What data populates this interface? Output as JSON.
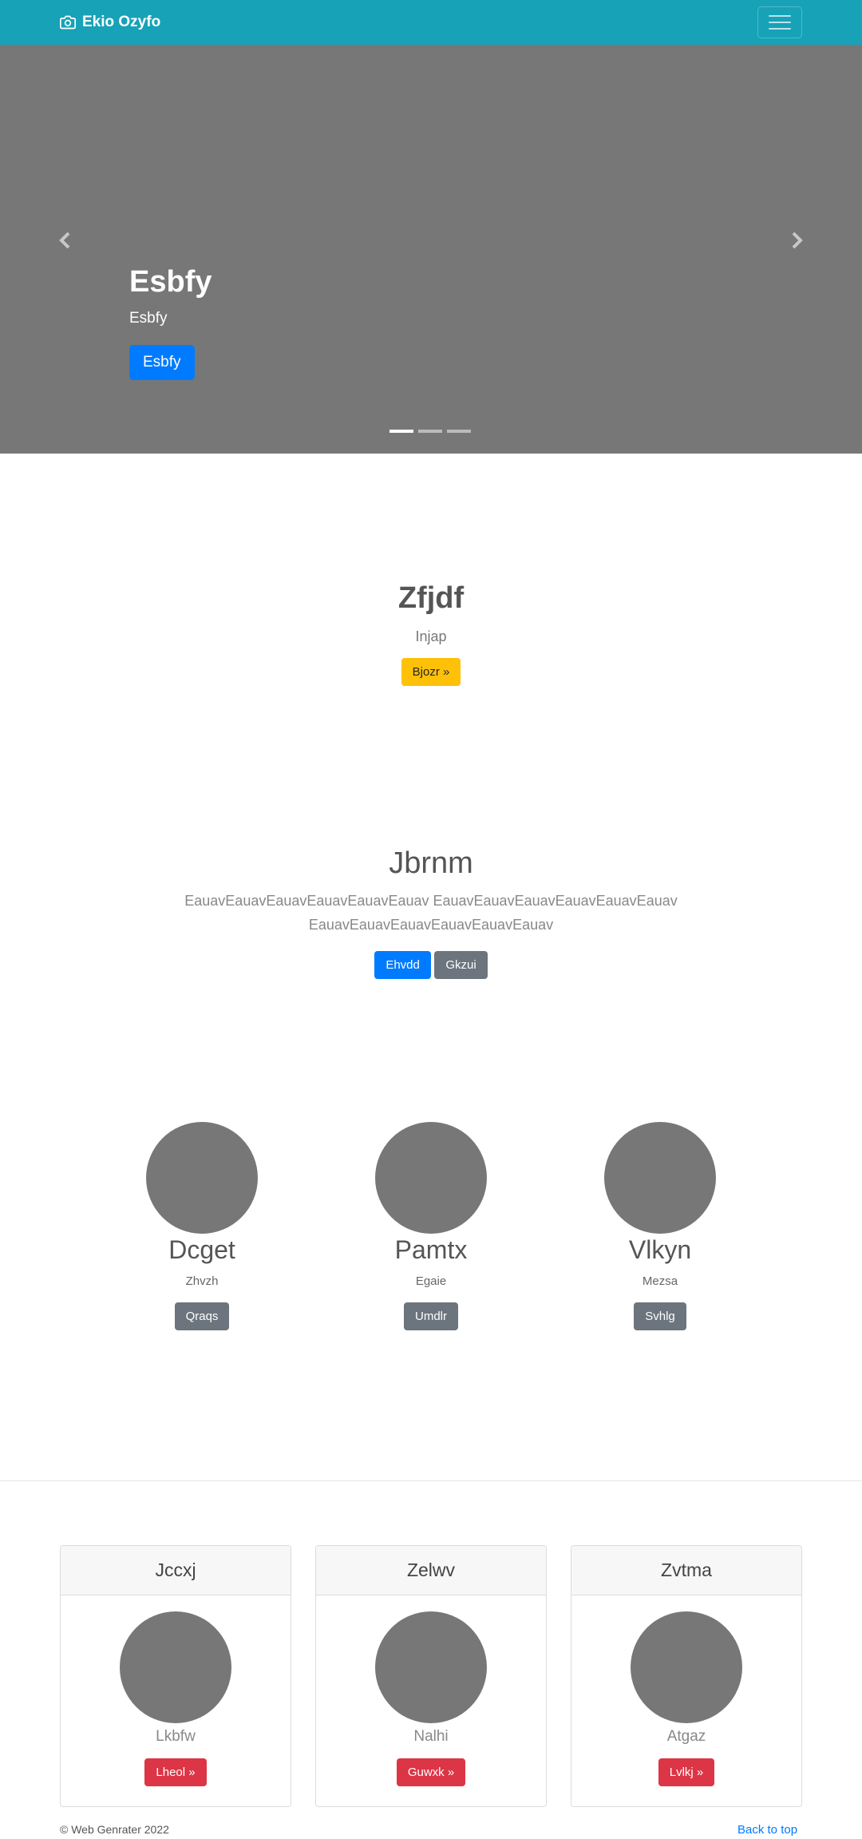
{
  "navbar": {
    "brand": "Ekio Ozyfo",
    "brand_icon": "camera-icon",
    "menu_icon": "hamburger-icon",
    "color": "#17a2b8"
  },
  "carousel": {
    "title": "Esbfy",
    "text": "Esbfy",
    "button": "Esbfy",
    "prev_icon": "chevron-left-icon",
    "next_icon": "chevron-right-icon",
    "slides": 3,
    "active_slide": 1
  },
  "feature": {
    "title": "Zfjdf",
    "subtitle": "Injap",
    "button": "Bjozr »"
  },
  "jumbo": {
    "title": "Jbrnm",
    "text": "EauavEauavEauavEauavEauavEauav EauavEauavEauavEauavEauavEauav EauavEauavEauavEauavEauavEauav",
    "primary_button": "Ehvdd",
    "secondary_button": "Gkzui"
  },
  "circles": [
    {
      "name": "Dcget",
      "sub": "Zhvzh",
      "button": "Qraqs"
    },
    {
      "name": "Pamtx",
      "sub": "Egaie",
      "button": "Umdlr"
    },
    {
      "name": "Vlkyn",
      "sub": "Mezsa",
      "button": "Svhlg"
    }
  ],
  "cards": [
    {
      "header": "Jccxj",
      "text": "Lkbfw",
      "button": "Lheol »"
    },
    {
      "header": "Zelwv",
      "text": "Nalhi",
      "button": "Guwxk »"
    },
    {
      "header": "Zvtma",
      "text": "Atgaz",
      "button": "Lvlkj »"
    }
  ],
  "footer": {
    "copyright": "© Web Genrater 2022",
    "back_to_top": "Back to top"
  }
}
